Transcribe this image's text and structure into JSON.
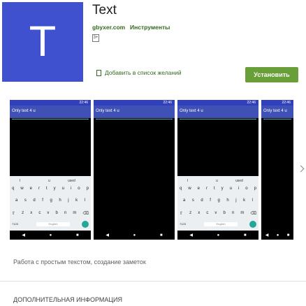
{
  "app": {
    "icon_letter": "T",
    "title": "Text",
    "developer": "gbyxer.com",
    "category": "Инструменты",
    "content_rating": "3+",
    "wishlist_label": "Добавить в список желаний",
    "install_label": "Установить"
  },
  "screenshots": [
    {
      "time": "22:46",
      "text": "Only text 4 u",
      "keyboard": true,
      "suggestions": [
        "I",
        "u",
        "used"
      ],
      "rows": [
        [
          "q",
          "w",
          "e",
          "r",
          "t",
          "y",
          "u",
          "i",
          "o",
          "p"
        ],
        [
          "a",
          "s",
          "d",
          "f",
          "g",
          "h",
          "j",
          "k",
          "l"
        ],
        [
          "⇧",
          "z",
          "x",
          "c",
          "v",
          "b",
          "n",
          "m",
          "⌫"
        ]
      ],
      "bottom_left": "?123",
      "space_label": "English"
    },
    {
      "time": "22:46",
      "text": "Only text 4 u",
      "keyboard": false
    },
    {
      "time": "22:46",
      "text": "Only text 4 u",
      "keyboard": true,
      "suggestions": [
        "I",
        "u",
        "used"
      ],
      "rows": [
        [
          "q",
          "w",
          "e",
          "r",
          "t",
          "y",
          "u",
          "i",
          "o",
          "p"
        ],
        [
          "a",
          "s",
          "d",
          "f",
          "g",
          "h",
          "j",
          "k",
          "l"
        ],
        [
          "⇧",
          "z",
          "x",
          "c",
          "v",
          "b",
          "n",
          "m",
          "⌫"
        ]
      ],
      "bottom_left": "?123",
      "space_label": "English"
    },
    {
      "time": "22:46",
      "text": "Only text 4 u",
      "keyboard": false
    }
  ],
  "description": "Работа с простым текстом, создание заметок",
  "more_info_heading": "ДОПОЛНИТЕЛЬНАЯ ИНФОРМАЦИЯ",
  "icons": {
    "wishlist": "bookmark-icon",
    "next": "chevron-right-icon",
    "rating": "age-rating-icon"
  }
}
